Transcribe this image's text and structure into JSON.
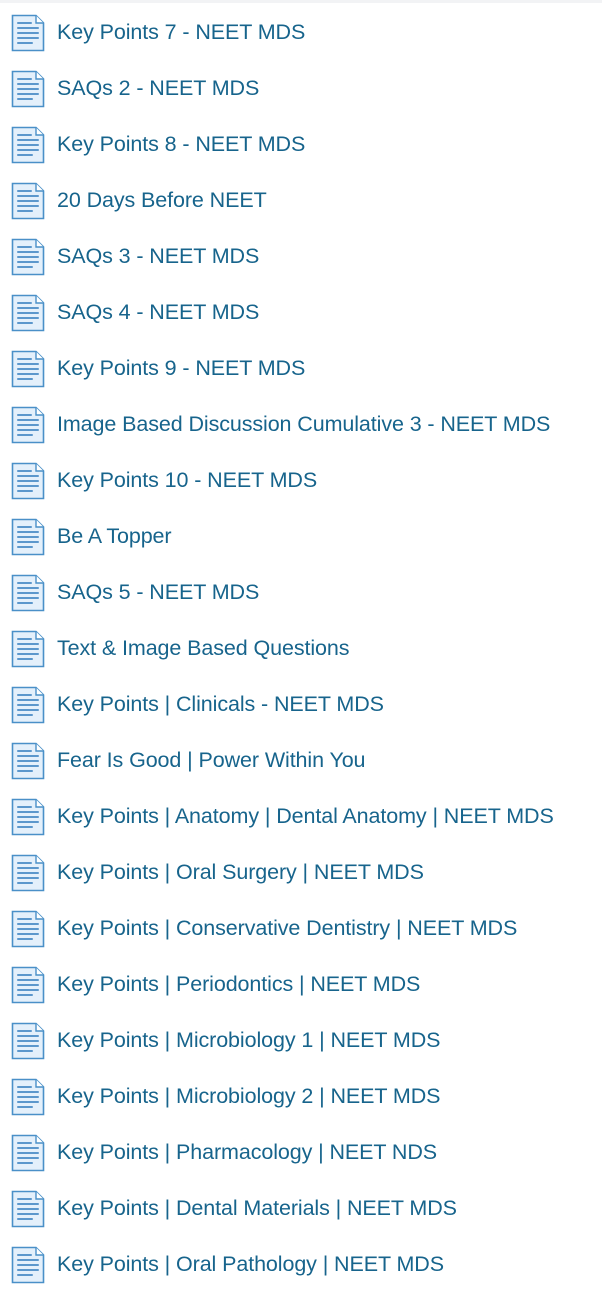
{
  "colors": {
    "link": "#17648c",
    "icon_frame": "#4a90c8",
    "icon_fill": "#e4f0fb",
    "icon_lines": "#5b97cc"
  },
  "icon_name": "document-file-icon",
  "resources": [
    {
      "label": "Key Points 7 - NEET MDS"
    },
    {
      "label": "SAQs 2 - NEET MDS"
    },
    {
      "label": "Key Points 8 - NEET MDS"
    },
    {
      "label": "20 Days Before NEET"
    },
    {
      "label": "SAQs 3 - NEET MDS"
    },
    {
      "label": "SAQs 4 - NEET MDS"
    },
    {
      "label": "Key Points 9 - NEET MDS"
    },
    {
      "label": "Image Based Discussion Cumulative 3 - NEET MDS"
    },
    {
      "label": "Key Points 10 - NEET MDS"
    },
    {
      "label": "Be A Topper"
    },
    {
      "label": "SAQs 5 - NEET MDS"
    },
    {
      "label": "Text & Image Based Questions"
    },
    {
      "label": "Key Points | Clinicals - NEET MDS"
    },
    {
      "label": "Fear Is Good | Power Within You"
    },
    {
      "label": "Key Points | Anatomy | Dental Anatomy | NEET MDS"
    },
    {
      "label": "Key Points | Oral Surgery | NEET MDS"
    },
    {
      "label": "Key Points | Conservative Dentistry | NEET MDS"
    },
    {
      "label": "Key Points | Periodontics | NEET MDS"
    },
    {
      "label": "Key Points | Microbiology 1 | NEET MDS"
    },
    {
      "label": "Key Points | Microbiology 2 | NEET MDS"
    },
    {
      "label": "Key Points | Pharmacology | NEET NDS"
    },
    {
      "label": "Key Points | Dental Materials | NEET MDS"
    },
    {
      "label": "Key Points | Oral Pathology | NEET MDS"
    }
  ]
}
